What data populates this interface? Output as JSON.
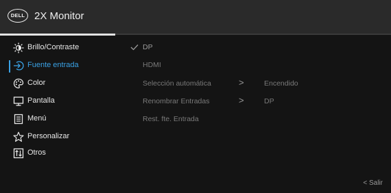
{
  "header": {
    "brand": "DELL",
    "title": "2X Monitor"
  },
  "menu": {
    "items": [
      {
        "label": "Brillo/Contraste",
        "icon": "brightness-icon"
      },
      {
        "label": "Fuente entrada",
        "icon": "input-source-icon",
        "active": true
      },
      {
        "label": "Color",
        "icon": "color-palette-icon"
      },
      {
        "label": "Pantalla",
        "icon": "display-icon"
      },
      {
        "label": "Menú",
        "icon": "menu-document-icon"
      },
      {
        "label": "Personalizar",
        "icon": "star-icon"
      },
      {
        "label": "Otros",
        "icon": "others-icon"
      }
    ]
  },
  "options": {
    "dp": "DP",
    "hdmi": "HDMI",
    "auto_select": "Selección automática",
    "auto_select_value": "Encendido",
    "rename": "Renombrar Entradas",
    "rename_value": "DP",
    "reset": "Rest. fte. Entrada"
  },
  "footer": {
    "exit": "Salir"
  },
  "colors": {
    "accent": "#3aa2e6",
    "background": "#141414",
    "header": "#2a2a2a"
  }
}
